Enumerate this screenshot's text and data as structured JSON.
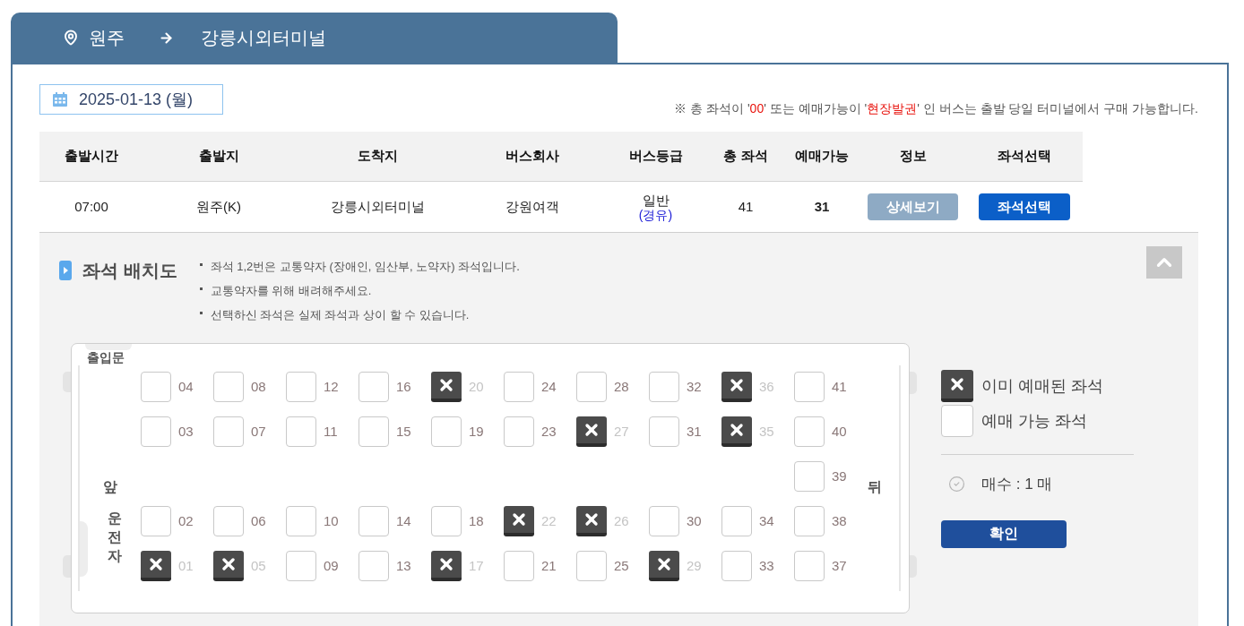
{
  "route": {
    "origin": "원주",
    "destination": "강릉시외터미널"
  },
  "date": "2025-01-13 (월)",
  "notice": [
    {
      "text": "※ 총 좌석이 '",
      "highlight": false
    },
    {
      "text": "00",
      "highlight": true
    },
    {
      "text": "' 또는 예매가능이 '",
      "highlight": false
    },
    {
      "text": "현장발권",
      "highlight": true
    },
    {
      "text": "' 인 버스는 출발 당일 터미널에서 구매 가능합니다.",
      "highlight": false
    }
  ],
  "table": {
    "columns": [
      "출발시간",
      "출발지",
      "도착지",
      "버스회사",
      "버스등급",
      "총 좌석",
      "예매가능",
      "정보",
      "좌석선택"
    ],
    "rows": [
      {
        "departure_time": "07:00",
        "origin": "원주(K)",
        "destination": "강릉시외터미널",
        "company": "강원여객",
        "grade": "일반",
        "route_type": "(경유)",
        "total_seats": "41",
        "available_seats": "31",
        "info_button": "상세보기",
        "select_button": "좌석선택"
      }
    ]
  },
  "seat_panel": {
    "title": "좌석 배치도",
    "notes": [
      "좌석 1,2번은 교통약자 (장애인, 임산부, 노약자) 좌석입니다.",
      "교통약자를 위해 배려해주세요.",
      "선택하신 좌석은 실제 좌석과 상이 할 수 있습니다."
    ]
  },
  "seat_map": {
    "door_label": "출입문",
    "front_label": "앞",
    "driver_label": "운전자",
    "rear_label": "뒤",
    "rows": [
      {
        "seats": [
          {
            "number": "04",
            "reserved": false
          },
          {
            "number": "08",
            "reserved": false
          },
          {
            "number": "12",
            "reserved": false
          },
          {
            "number": "16",
            "reserved": false
          },
          {
            "number": "20",
            "reserved": true
          },
          {
            "number": "24",
            "reserved": false
          },
          {
            "number": "28",
            "reserved": false
          },
          {
            "number": "32",
            "reserved": false
          },
          {
            "number": "36",
            "reserved": true
          },
          {
            "number": "41",
            "reserved": false
          }
        ]
      },
      {
        "seats": [
          {
            "number": "03",
            "reserved": false
          },
          {
            "number": "07",
            "reserved": false
          },
          {
            "number": "11",
            "reserved": false
          },
          {
            "number": "15",
            "reserved": false
          },
          {
            "number": "19",
            "reserved": false
          },
          {
            "number": "23",
            "reserved": false
          },
          {
            "number": "27",
            "reserved": true
          },
          {
            "number": "31",
            "reserved": false
          },
          {
            "number": "35",
            "reserved": true
          },
          {
            "number": "40",
            "reserved": false
          }
        ]
      },
      {
        "seats": [
          {
            "number": "39",
            "reserved": false
          }
        ]
      },
      {
        "seats": [
          {
            "number": "02",
            "reserved": false
          },
          {
            "number": "06",
            "reserved": false
          },
          {
            "number": "10",
            "reserved": false
          },
          {
            "number": "14",
            "reserved": false
          },
          {
            "number": "18",
            "reserved": false
          },
          {
            "number": "22",
            "reserved": true
          },
          {
            "number": "26",
            "reserved": true
          },
          {
            "number": "30",
            "reserved": false
          },
          {
            "number": "34",
            "reserved": false
          },
          {
            "number": "38",
            "reserved": false
          }
        ]
      },
      {
        "seats": [
          {
            "number": "01",
            "reserved": true
          },
          {
            "number": "05",
            "reserved": true
          },
          {
            "number": "09",
            "reserved": false
          },
          {
            "number": "13",
            "reserved": false
          },
          {
            "number": "17",
            "reserved": true
          },
          {
            "number": "21",
            "reserved": false
          },
          {
            "number": "25",
            "reserved": false
          },
          {
            "number": "29",
            "reserved": true
          },
          {
            "number": "33",
            "reserved": false
          },
          {
            "number": "37",
            "reserved": false
          }
        ]
      }
    ]
  },
  "legend": [
    {
      "kind": "reserved",
      "label": "이미 예매된 좌석"
    },
    {
      "kind": "available",
      "label": "예매 가능 좌석"
    }
  ],
  "ticket_count": "매수 : 1 매",
  "confirm_button": "확인"
}
